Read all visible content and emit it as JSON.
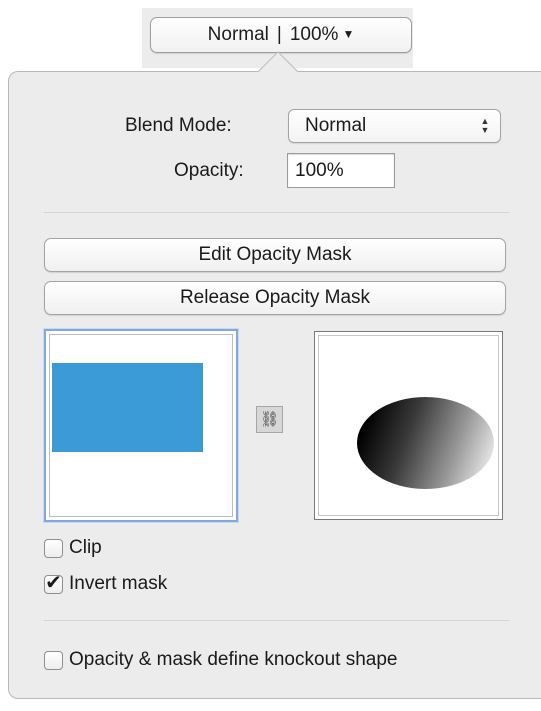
{
  "toolbar": {
    "mode_label": "Normal",
    "separator": "|",
    "opacity_label": "100%"
  },
  "blend": {
    "label": "Blend Mode:",
    "value": "Normal"
  },
  "opacity": {
    "label": "Opacity:",
    "value": "100%"
  },
  "buttons": {
    "edit_mask": "Edit Opacity Mask",
    "release_mask": "Release Opacity Mask"
  },
  "thumbnails": {
    "artwork_fill": "#3b9bd6",
    "linked": true
  },
  "checkboxes": {
    "clip": {
      "label": "Clip",
      "checked": false
    },
    "invert_mask": {
      "label": "Invert mask",
      "checked": true
    },
    "knockout": {
      "label": "Opacity & mask define knockout shape",
      "checked": false
    }
  },
  "icons": {
    "dropdown": "chevron-down-icon",
    "stepper": "up-down-arrows-icon",
    "link": "chain-link-icon",
    "check": "checkmark-icon"
  }
}
